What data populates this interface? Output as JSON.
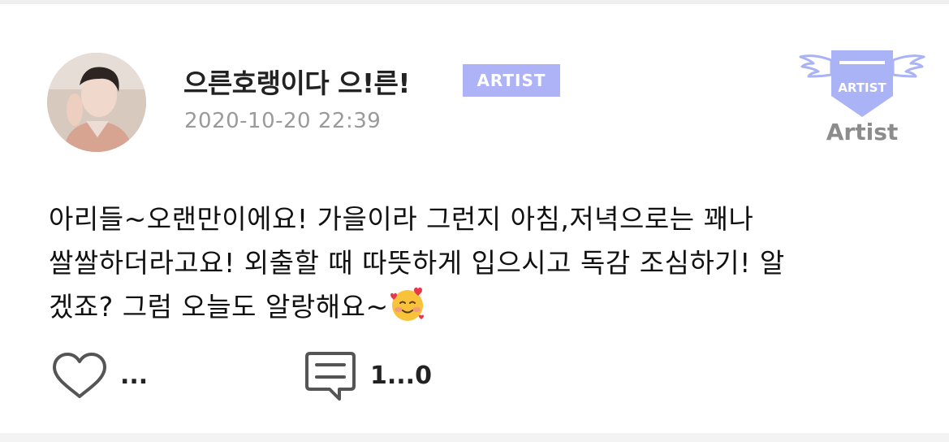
{
  "post": {
    "author": {
      "name": "으른호랭이다 으!른!",
      "badge": "ARTIST"
    },
    "timestamp": "2020-10-20 22:39",
    "emblem": {
      "label": "ARTIST",
      "caption": "Artist"
    },
    "body": "아리들~오랜만이에요! 가을이라 그런지 아침,저녁으로는 꽤나\n쌀쌀하더라고요! 외출할 때 따뜻하게 입으시고 독감 조심하기! 알\n겠죠? 그럼 오늘도 알랑해요~",
    "body_emoji": "smiling-face-with-hearts",
    "actions": {
      "like_count": "...",
      "comment_count": "1...0"
    }
  },
  "colors": {
    "badge": "#aeb3f8",
    "emblem": "#a9b3f5",
    "timestamp": "#9a9a9a",
    "icon": "#555555"
  },
  "icons": [
    "heart-icon",
    "comment-icon",
    "artist-wings-icon",
    "smiling-face-with-hearts-emoji"
  ]
}
